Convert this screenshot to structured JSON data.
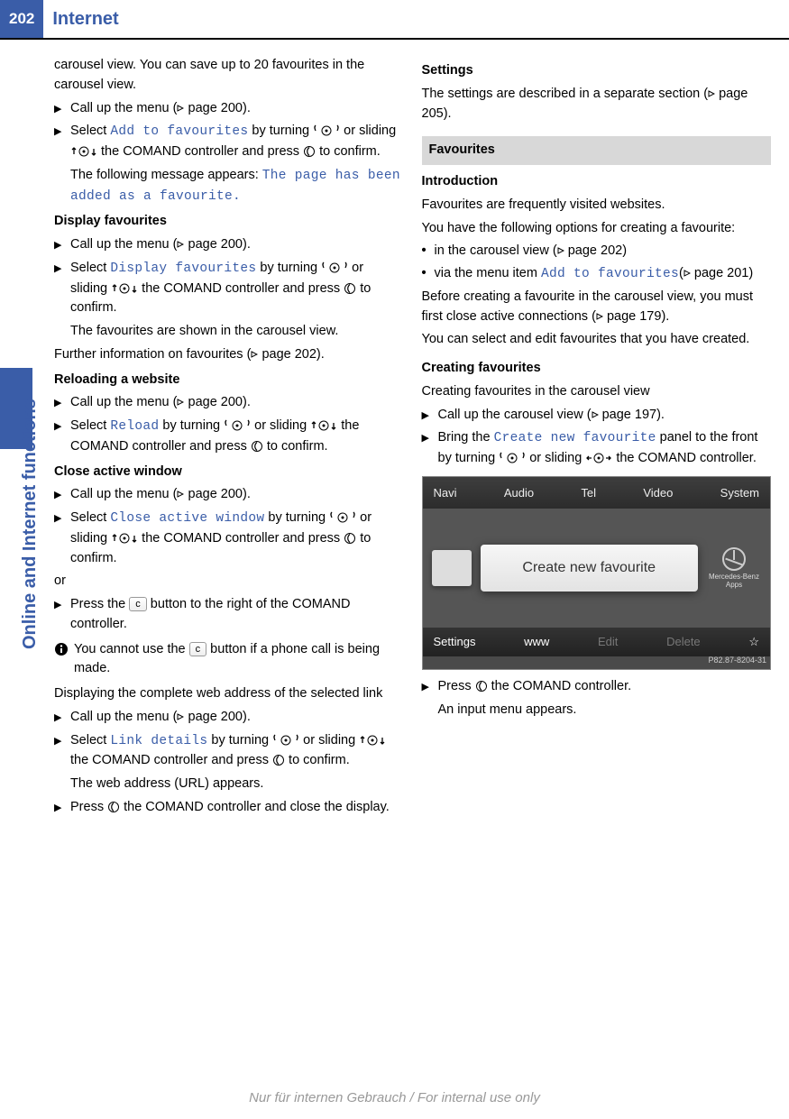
{
  "header": {
    "page_number": "202",
    "title": "Internet"
  },
  "sidebar": {
    "title": "Online and Internet functions"
  },
  "left": {
    "intro": "carousel view. You can save up to 20 favourites in the carousel view.",
    "step1": {
      "pre": "Call up the menu (",
      "link": "page 200",
      "post": ")."
    },
    "step2": {
      "pre": "Select ",
      "ui": "Add to favourites",
      "mid": " by turning ",
      "mid2": " or sliding ",
      "mid3": " the COMAND controller and press ",
      "end": " to confirm."
    },
    "step2_result_pre": "The following message appears: ",
    "step2_result_ui": "The page has been added as a favourite.",
    "display_fav_h": "Display favourites",
    "df_step1": {
      "pre": "Call up the menu (",
      "link": "page 200",
      "post": ")."
    },
    "df_step2": {
      "pre": "Select ",
      "ui": "Display favourites",
      "mid": " by turning ",
      "mid2": " or sliding ",
      "mid3": " the COMAND controller and press ",
      "end": " to confirm."
    },
    "df_result": "The favourites are shown in the carousel view.",
    "further_pre": "Further information on favourites (",
    "further_link": "page 202",
    "further_post": ").",
    "reload_h": "Reloading a website",
    "rl_step1": {
      "pre": "Call up the menu (",
      "link": "page 200",
      "post": ")."
    },
    "rl_step2": {
      "pre": "Select ",
      "ui": "Reload",
      "mid": " by turning ",
      "mid2": " or sliding ",
      "mid3": " the COMAND controller and press ",
      "end": " to confirm."
    },
    "close_h": "Close active window",
    "cl_step1": {
      "pre": "Call up the menu (",
      "link": "page 200",
      "post": ")."
    },
    "cl_step2": {
      "pre": "Select ",
      "ui": "Close active window",
      "mid": " by turning ",
      "mid2": " or sliding ",
      "mid3": " the COMAND controller and press ",
      "end": " to confirm."
    },
    "or": "or",
    "cl_step3": {
      "pre": "Press the ",
      "key": "c",
      "post": " button to the right of the COMAND controller."
    },
    "info": {
      "pre": "You cannot use the ",
      "key": "c",
      "post": " button if a phone call is being made."
    },
    "disp_addr": "Displaying the complete web address of the selected link",
    "da_step1": {
      "pre": "Call up the menu (",
      "link": "page 200",
      "post": ")."
    },
    "da_step2": {
      "pre": "Select ",
      "ui": "Link details",
      "mid": " by turning ",
      "mid2": " or sliding ",
      "mid3": " the COMAND controller and press ",
      "end": " to confirm."
    },
    "da_result": "The web address (URL) appears.",
    "da_step3": {
      "pre": "Press ",
      "post": " the COMAND controller and close the display."
    }
  },
  "right": {
    "settings_h": "Settings",
    "settings_p_pre": "The settings are described in a separate section (",
    "settings_link": "page 205",
    "settings_p_post": ").",
    "fav_section": "Favourites",
    "intro_h": "Introduction",
    "intro_p1": "Favourites are frequently visited websites.",
    "intro_p2": "You have the following options for creating a favourite:",
    "b1_pre": "in the carousel view (",
    "b1_link": "page 202",
    "b1_post": ")",
    "b2_pre": "via the menu item ",
    "b2_ui": "Add to favourites",
    "b2_mid": "(",
    "b2_link": "page 201",
    "b2_post": ")",
    "intro_p3_pre": "Before creating a favourite in the carousel view, you must first close active connections (",
    "intro_p3_link": "page 179",
    "intro_p3_post": ").",
    "intro_p4": "You can select and edit favourites that you have created.",
    "create_h": "Creating favourites",
    "create_p1": "Creating favourites in the carousel view",
    "cr_step1": {
      "pre": "Call up the carousel view (",
      "link": "page 197",
      "post": ")."
    },
    "cr_step2": {
      "pre": "Bring the ",
      "ui": "Create new favourite",
      "mid": " panel to the front by turning ",
      "mid2": " or sliding ",
      "end": " the COMAND controller."
    },
    "shot": {
      "top": [
        "Navi",
        "Audio",
        "Tel",
        "Video",
        "System"
      ],
      "center": "Create new favourite",
      "logo": "Mercedes-Benz Apps",
      "bottom": [
        "Settings",
        "www",
        "Edit",
        "Delete"
      ],
      "caption": "P82.87-8204-31"
    },
    "cr_step3": {
      "pre": "Press ",
      "post": " the COMAND controller."
    },
    "cr_result": "An input menu appears."
  },
  "footer": "Nur für internen Gebrauch / For internal use only"
}
